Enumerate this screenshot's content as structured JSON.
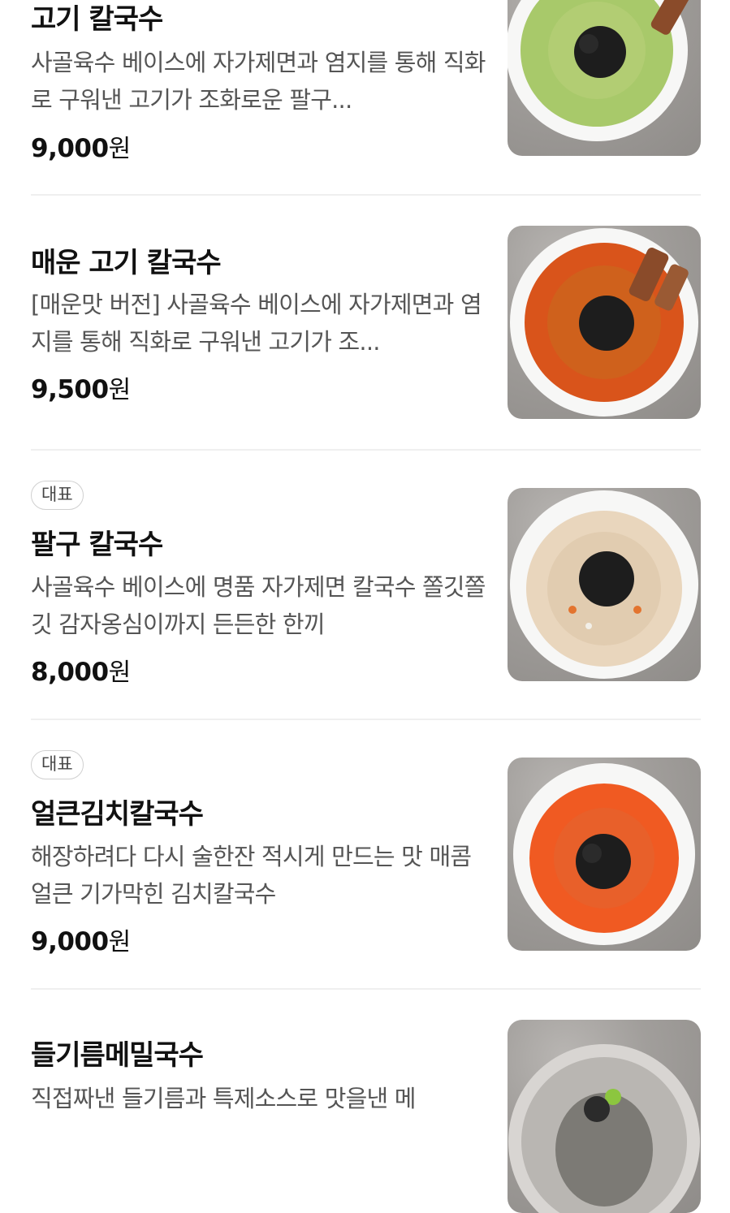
{
  "menu": {
    "items": [
      {
        "badge": "",
        "name": "고기 칼국수",
        "description": "사골육수 베이스에 자가제면과 염지를 통해 직화로 구워낸 고기가 조화로운 팔구...",
        "price": "9,000",
        "currency": "원",
        "image_icon": "beef-kalguksu-photo",
        "broth_color": "#a8c96a"
      },
      {
        "badge": "",
        "name": "매운 고기 칼국수",
        "description": "[매운맛 버전] 사골육수 베이스에 자가제면과 염지를 통해 직화로 구워낸 고기가 조...",
        "price": "9,500",
        "currency": "원",
        "image_icon": "spicy-beef-kalguksu-photo",
        "broth_color": "#d9541b"
      },
      {
        "badge": "대표",
        "name": "팔구 칼국수",
        "description": "사골육수 베이스에 명품 자가제면 칼국수 쫄깃쫄깃 감자옹심이까지 든든한 한끼",
        "price": "8,000",
        "currency": "원",
        "image_icon": "palgu-kalguksu-photo",
        "broth_color": "#e9d6bd"
      },
      {
        "badge": "대표",
        "name": "얼큰김치칼국수",
        "description": "해장하려다 다시 술한잔 적시게 만드는 맛 매콤 얼큰 기가막힌 김치칼국수",
        "price": "9,000",
        "currency": "원",
        "image_icon": "kimchi-kalguksu-photo",
        "broth_color": "#f05a22"
      },
      {
        "badge": "",
        "name": "들기름메밀국수",
        "description": "직접짜낸 들기름과 특제소스로 맛을낸 메",
        "price": "",
        "currency": "",
        "image_icon": "perilla-buckwheat-noodle-photo",
        "broth_color": "#c8c3bd"
      }
    ]
  },
  "colors": {
    "text_primary": "#111111",
    "text_secondary": "#555555",
    "divider": "#efefef",
    "badge_border": "#d0d0d0"
  }
}
